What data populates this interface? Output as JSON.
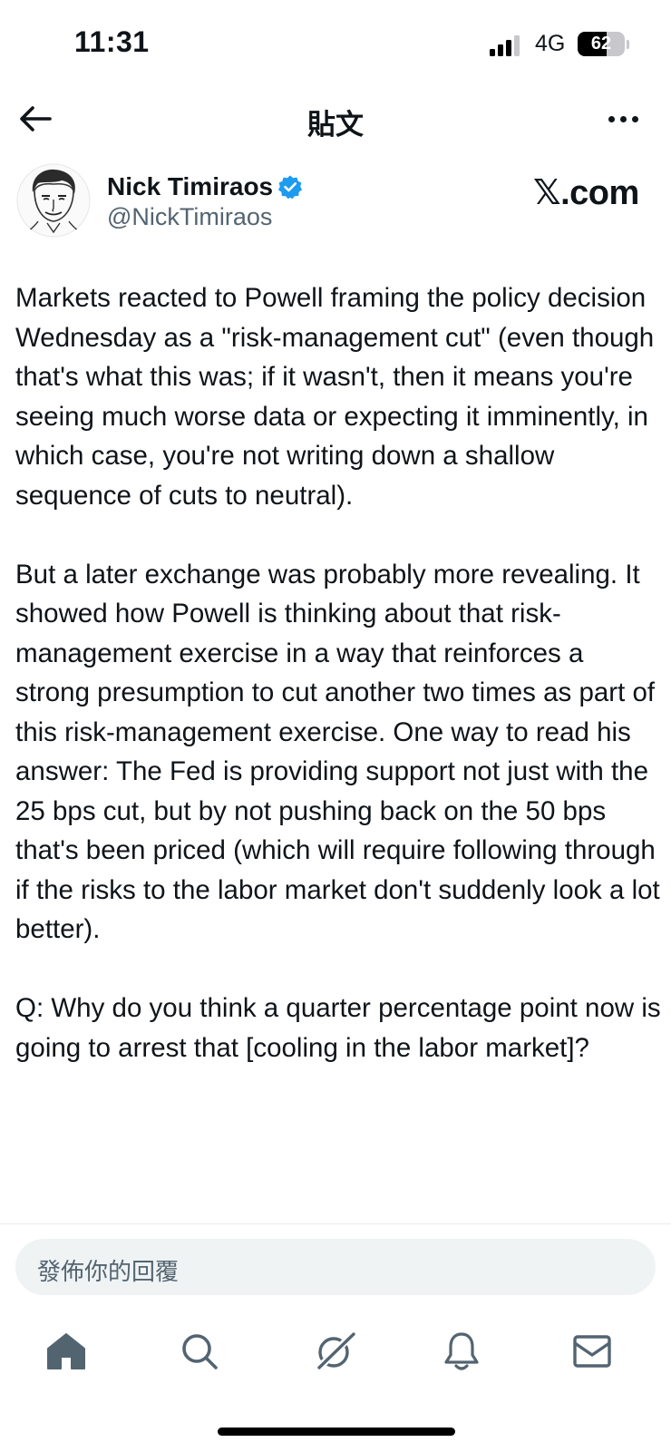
{
  "status_bar": {
    "time": "11:31",
    "network": "4G",
    "battery": "62",
    "battery_level_percent": 62
  },
  "header": {
    "title": "貼文",
    "back_icon": "arrow-left-icon",
    "more_icon": "more-horizontal-icon"
  },
  "author": {
    "display_name": "Nick Timiraos",
    "handle": "@NickTimiraos",
    "verified_color": "#1d9bf0",
    "source_logo": "𝕏.com"
  },
  "tweet": {
    "paragraphs": [
      "Markets reacted to Powell framing the policy decision Wednesday as a \"risk-management cut\" (even though that's what this was; if it wasn't, then it means you're seeing much worse data or expecting it imminently, in which case, you're not writing down a shallow sequence of cuts to neutral).",
      "But a later exchange was probably more revealing. It showed how Powell is thinking about that risk-management exercise in a way that reinforces a strong presumption to cut another two times as part of this risk-management exercise. One way to read his answer: The Fed is providing support not just with the 25 bps cut, but by not pushing back on the 50 bps that's been priced (which will require following through if the risks to the labor market don't suddenly look a lot better).",
      "Q: Why do you think a quarter percentage point now is going to arrest that [cooling in the labor market]?"
    ]
  },
  "reply": {
    "placeholder": "發佈你的回覆"
  },
  "tab_bar": {
    "items": [
      {
        "icon": "home-icon"
      },
      {
        "icon": "search-icon"
      },
      {
        "icon": "grok-icon"
      },
      {
        "icon": "bell-icon"
      },
      {
        "icon": "mail-icon"
      }
    ]
  }
}
